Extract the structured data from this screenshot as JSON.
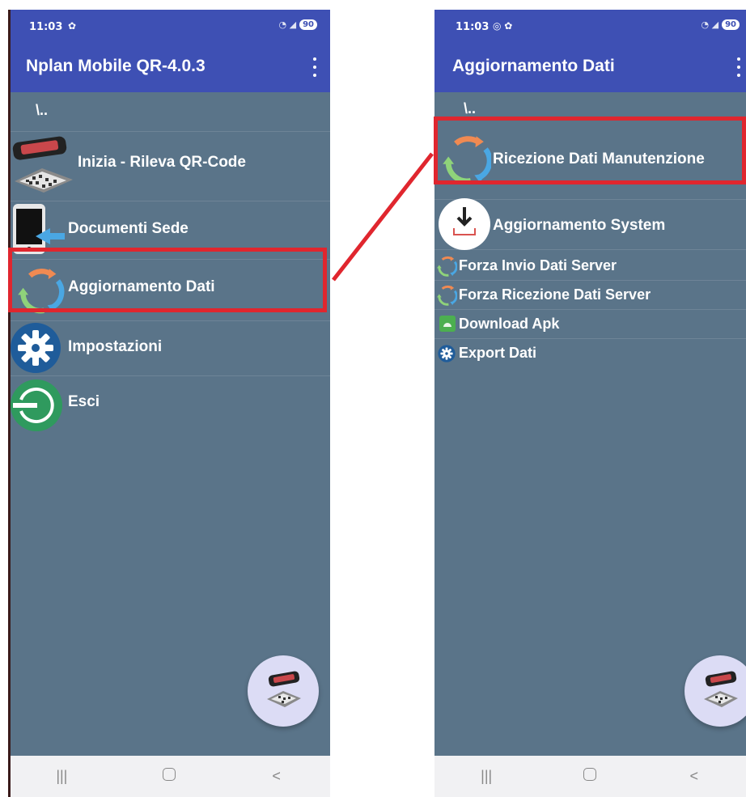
{
  "status": {
    "left_time": "11:03",
    "left_battery": "90",
    "right_time": "11:03",
    "right_battery": "90"
  },
  "left_screen": {
    "title": "Nplan Mobile QR-4.0.3",
    "menu": [
      {
        "label": "\\..",
        "icon": "back-path"
      },
      {
        "label": "Inizia - Rileva QR-Code",
        "icon": "qr-scan-icon"
      },
      {
        "label": "Documenti Sede",
        "icon": "phone-document-icon"
      },
      {
        "label": "Aggiornamento Dati",
        "icon": "sync-icon"
      },
      {
        "label": "Impostazioni",
        "icon": "gear-icon"
      },
      {
        "label": "Esci",
        "icon": "exit-icon"
      }
    ]
  },
  "right_screen": {
    "title": "Aggiornamento Dati",
    "menu": [
      {
        "label": "\\..",
        "icon": "back-path"
      },
      {
        "label": "Ricezione Dati Manutenzione",
        "icon": "sync-icon"
      },
      {
        "label": "Aggiornamento System",
        "icon": "download-icon"
      },
      {
        "label": "Forza Invio Dati Server",
        "icon": "sync-icon"
      },
      {
        "label": "Forza Ricezione Dati Server",
        "icon": "sync-icon"
      },
      {
        "label": "Download Apk",
        "icon": "android-icon"
      },
      {
        "label": "Export Dati",
        "icon": "gear-icon"
      }
    ]
  },
  "colors": {
    "app_bar": "#3e50b4",
    "list_background": "#5a7489",
    "highlight": "#e0262e",
    "fab": "#dcdcf5",
    "nav_bar": "#f1f1f3"
  }
}
